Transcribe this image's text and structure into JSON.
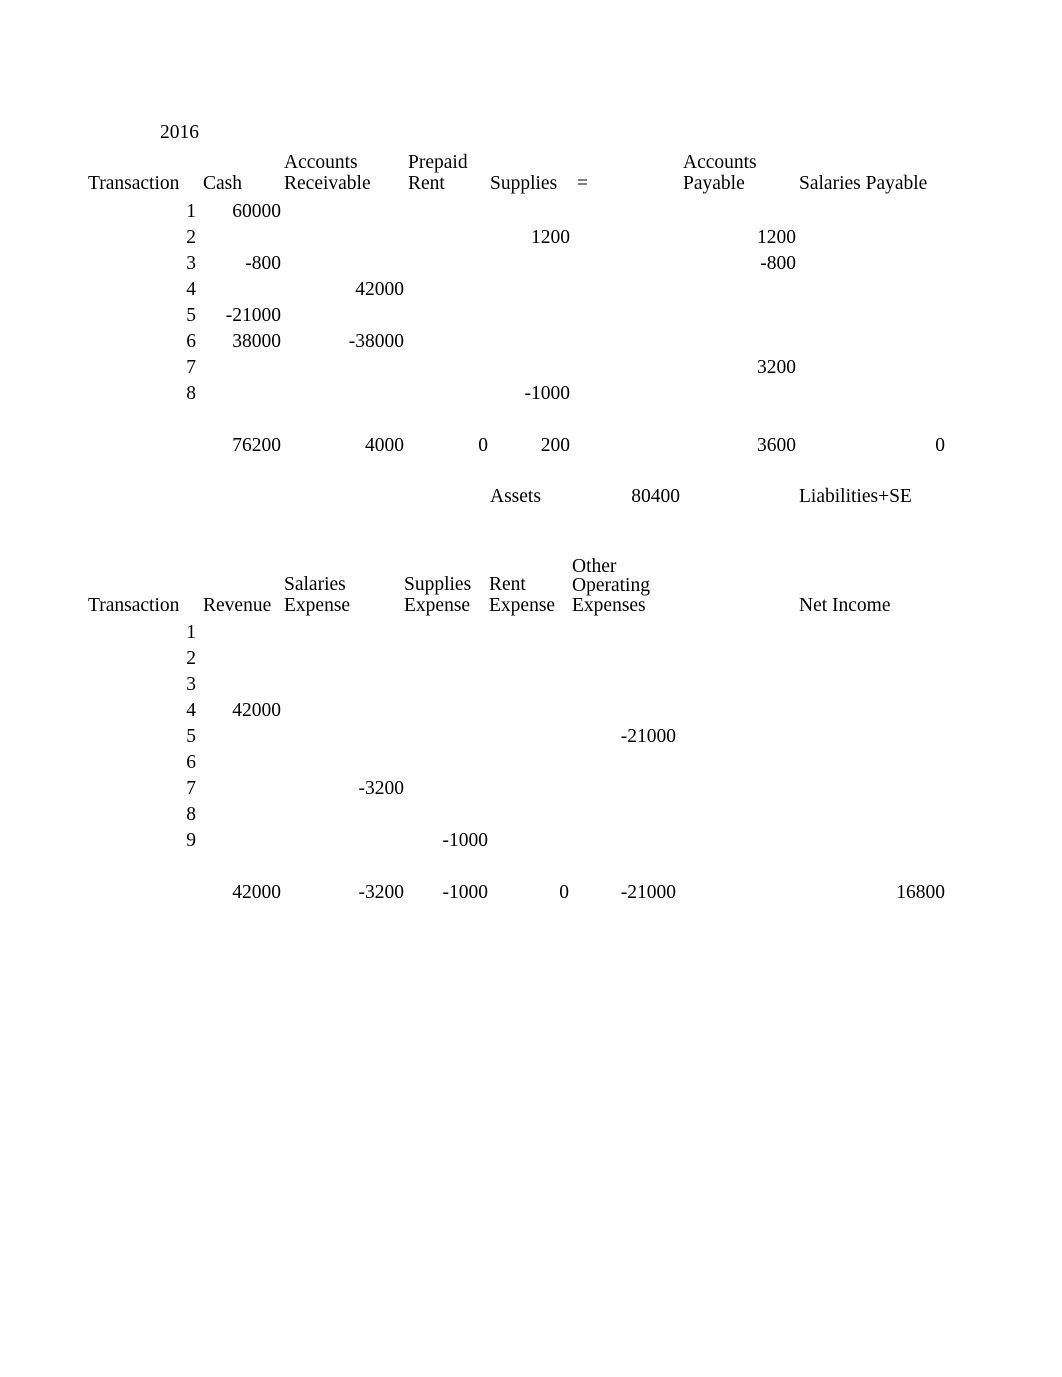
{
  "document": {
    "year_label": "2016"
  },
  "balance_sheet_table": {
    "headers": {
      "transaction": "Transaction",
      "cash": "Cash",
      "accounts_receivable_line1": "Accounts",
      "accounts_receivable_line2": "Receivable",
      "prepaid_rent_line1": "Prepaid",
      "prepaid_rent_line2": "Rent",
      "supplies": "Supplies",
      "equals": "=",
      "accounts_payable_line1": "Accounts",
      "accounts_payable_line2": "Payable",
      "salaries_payable": "Salaries Payable"
    },
    "rows": [
      {
        "transaction": "1",
        "cash": "60000",
        "accounts_receivable": "",
        "prepaid_rent": "",
        "supplies": "",
        "accounts_payable": "",
        "salaries_payable": ""
      },
      {
        "transaction": "2",
        "cash": "",
        "accounts_receivable": "",
        "prepaid_rent": "",
        "supplies": "1200",
        "accounts_payable": "1200",
        "salaries_payable": ""
      },
      {
        "transaction": "3",
        "cash": "-800",
        "accounts_receivable": "",
        "prepaid_rent": "",
        "supplies": "",
        "accounts_payable": "-800",
        "salaries_payable": ""
      },
      {
        "transaction": "4",
        "cash": "",
        "accounts_receivable": "42000",
        "prepaid_rent": "",
        "supplies": "",
        "accounts_payable": "",
        "salaries_payable": ""
      },
      {
        "transaction": "5",
        "cash": "-21000",
        "accounts_receivable": "",
        "prepaid_rent": "",
        "supplies": "",
        "accounts_payable": "",
        "salaries_payable": ""
      },
      {
        "transaction": "6",
        "cash": "38000",
        "accounts_receivable": "-38000",
        "prepaid_rent": "",
        "supplies": "",
        "accounts_payable": "",
        "salaries_payable": ""
      },
      {
        "transaction": "7",
        "cash": "",
        "accounts_receivable": "",
        "prepaid_rent": "",
        "supplies": "",
        "accounts_payable": "3200",
        "salaries_payable": ""
      },
      {
        "transaction": "8",
        "cash": "",
        "accounts_receivable": "",
        "prepaid_rent": "",
        "supplies": "-1000",
        "accounts_payable": "",
        "salaries_payable": ""
      }
    ],
    "totals": {
      "cash": "76200",
      "accounts_receivable": "4000",
      "prepaid_rent": "0",
      "supplies": "200",
      "accounts_payable": "3600",
      "salaries_payable": "0"
    },
    "footer": {
      "assets_label": "Assets",
      "assets_value": "80400",
      "liabilities_label": "Liabilities+SE"
    }
  },
  "income_statement_table": {
    "headers": {
      "transaction": "Transaction",
      "revenue": "Revenue",
      "salaries_expense_line1": "Salaries",
      "salaries_expense_line2": "Expense",
      "supplies_expense_line1": "Supplies",
      "supplies_expense_line2": "Expense",
      "rent_expense_line1": "Rent",
      "rent_expense_line2": "Expense",
      "other_operating_line1": "Other",
      "other_operating_line2": "Operating",
      "other_operating_line3": "Expenses",
      "net_income": "Net Income"
    },
    "rows": [
      {
        "transaction": "1",
        "revenue": "",
        "salaries_expense": "",
        "supplies_expense": "",
        "rent_expense": "",
        "other_operating_expenses": ""
      },
      {
        "transaction": "2",
        "revenue": "",
        "salaries_expense": "",
        "supplies_expense": "",
        "rent_expense": "",
        "other_operating_expenses": ""
      },
      {
        "transaction": "3",
        "revenue": "",
        "salaries_expense": "",
        "supplies_expense": "",
        "rent_expense": "",
        "other_operating_expenses": ""
      },
      {
        "transaction": "4",
        "revenue": "42000",
        "salaries_expense": "",
        "supplies_expense": "",
        "rent_expense": "",
        "other_operating_expenses": ""
      },
      {
        "transaction": "5",
        "revenue": "",
        "salaries_expense": "",
        "supplies_expense": "",
        "rent_expense": "",
        "other_operating_expenses": "-21000"
      },
      {
        "transaction": "6",
        "revenue": "",
        "salaries_expense": "",
        "supplies_expense": "",
        "rent_expense": "",
        "other_operating_expenses": ""
      },
      {
        "transaction": "7",
        "revenue": "",
        "salaries_expense": "-3200",
        "supplies_expense": "",
        "rent_expense": "",
        "other_operating_expenses": ""
      },
      {
        "transaction": "8",
        "revenue": "",
        "salaries_expense": "",
        "supplies_expense": "",
        "rent_expense": "",
        "other_operating_expenses": ""
      },
      {
        "transaction": "9",
        "revenue": "",
        "salaries_expense": "",
        "supplies_expense": "-1000",
        "rent_expense": "",
        "other_operating_expenses": ""
      }
    ],
    "totals": {
      "revenue": "42000",
      "salaries_expense": "-3200",
      "supplies_expense": "-1000",
      "rent_expense": "0",
      "other_operating_expenses": "-21000",
      "net_income": "16800"
    }
  }
}
